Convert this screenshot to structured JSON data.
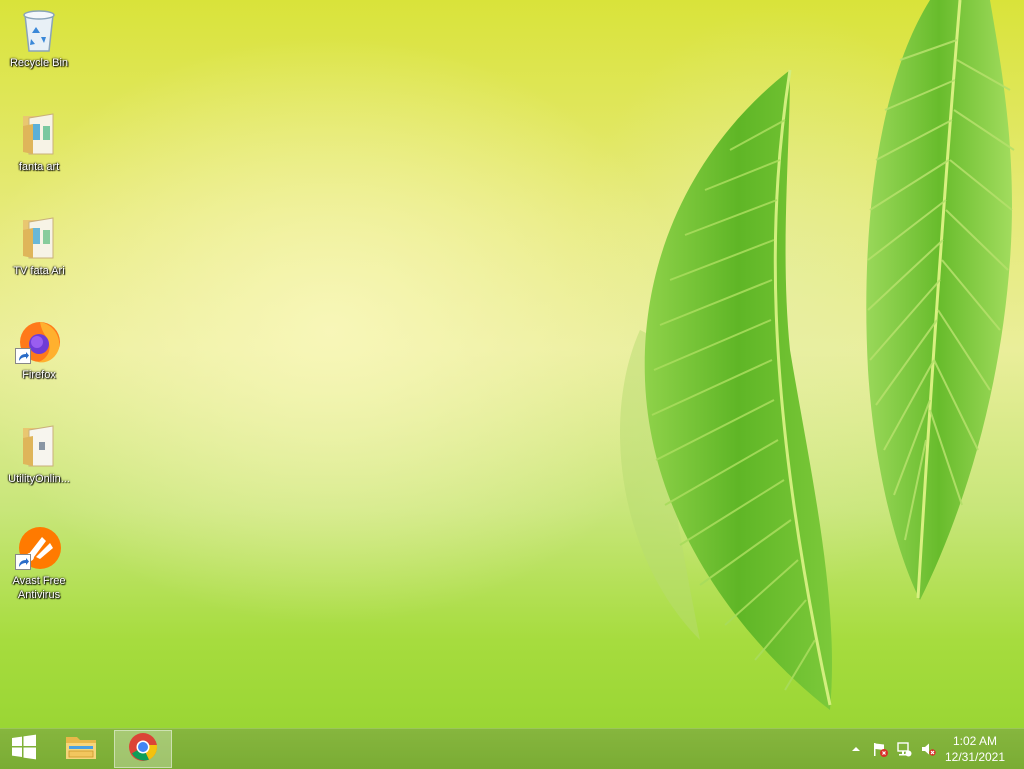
{
  "desktop": {
    "icons": [
      {
        "label": "Recycle Bin",
        "icon": "recycle-bin-icon"
      },
      {
        "label": "fanta art",
        "icon": "folder-icon"
      },
      {
        "label": "TV  fata Ari",
        "icon": "folder-icon"
      },
      {
        "label": "Firefox",
        "icon": "firefox-icon"
      },
      {
        "label": "UtilityOnlin...",
        "icon": "folder-icon"
      },
      {
        "label": "Avast Free Antivirus",
        "icon": "avast-icon"
      }
    ]
  },
  "taskbar": {
    "pinned": [
      {
        "app": "start",
        "icon": "windows-logo-icon"
      },
      {
        "app": "file-explorer",
        "icon": "file-explorer-icon"
      },
      {
        "app": "chrome",
        "icon": "chrome-icon",
        "active": true
      }
    ],
    "tray": {
      "icons": [
        "chevron-up-icon",
        "action-center-flag-icon",
        "network-icon",
        "speaker-muted-icon"
      ]
    },
    "clock": {
      "time": "1:02 AM",
      "date": "12/31/2021"
    }
  },
  "colors": {
    "taskbar": "#7aac34",
    "wallpaper_top": "#d9e33a",
    "wallpaper_bottom": "#9ad634",
    "leaf": "#6cc22a"
  }
}
